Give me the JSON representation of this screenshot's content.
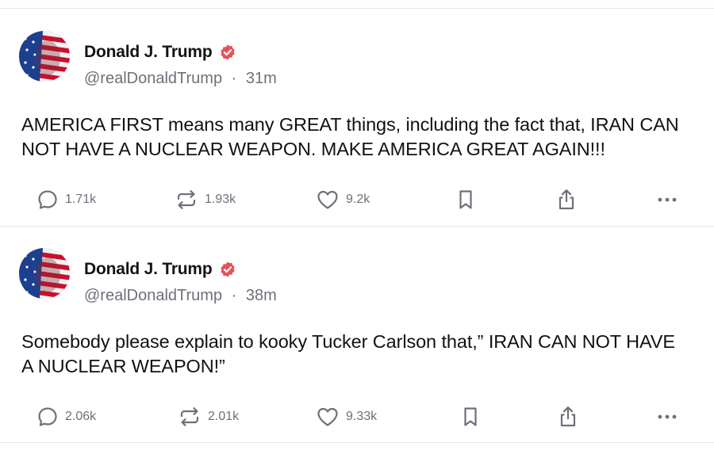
{
  "posts": [
    {
      "author": "Donald J. Trump",
      "handle": "@realDonaldTrump",
      "time_sep": "·",
      "time": "31m",
      "text": "AMERICA FIRST means many GREAT things, including the fact that, IRAN CAN NOT HAVE A NUCLEAR WEAPON. MAKE AMERICA GREAT AGAIN!!!",
      "replies": "1.71k",
      "reposts": "1.93k",
      "likes": "9.2k"
    },
    {
      "author": "Donald J. Trump",
      "handle": "@realDonaldTrump",
      "time_sep": "·",
      "time": "38m",
      "text": "Somebody please explain to kooky Tucker Carlson that,” IRAN CAN NOT HAVE A NUCLEAR WEAPON!”",
      "replies": "2.06k",
      "reposts": "2.01k",
      "likes": "9.33k"
    }
  ],
  "icons": {
    "reply": "reply-icon",
    "repost": "repost-icon",
    "like": "heart-icon",
    "bookmark": "bookmark-icon",
    "share": "share-icon",
    "more": "more-icon",
    "verified": "verified-badge-icon"
  },
  "colors": {
    "verified_badge": "#e8505b",
    "icon_gray": "#6f6f7a",
    "divider": "#e7e7ea"
  }
}
